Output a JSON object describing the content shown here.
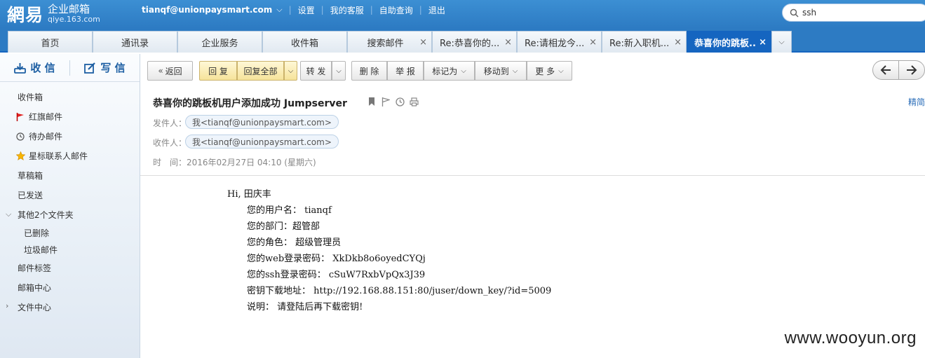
{
  "header": {
    "logo_brand": "網易",
    "logo_title": "企业邮箱",
    "logo_domain": "qiye.163.com",
    "user": "tianqf@unionpaysmart.com",
    "links": [
      "设置",
      "我的客服",
      "自助查询",
      "退出"
    ],
    "search_value": "ssh"
  },
  "tabs": [
    {
      "label": "首页"
    },
    {
      "label": "通讯录"
    },
    {
      "label": "企业服务"
    },
    {
      "label": "收件箱"
    },
    {
      "label": "搜索邮件"
    },
    {
      "label": "Re:恭喜你的..."
    },
    {
      "label": "Re:请相龙今..."
    },
    {
      "label": "Re:新入职机..."
    },
    {
      "label": "恭喜你的跳板.."
    }
  ],
  "sidebar": {
    "receive": "收 信",
    "compose": "写 信",
    "folders": [
      "收件箱",
      "红旗邮件",
      "待办邮件",
      "星标联系人邮件",
      "草稿箱",
      "已发送",
      "其他2个文件夹",
      "已删除",
      "垃圾邮件",
      "邮件标签",
      "邮箱中心",
      "文件中心"
    ]
  },
  "toolbar": {
    "back": "返回",
    "reply": "回 复",
    "reply_all": "回复全部",
    "forward": "转 发",
    "delete": "删 除",
    "report": "举 报",
    "mark_as": "标记为",
    "move_to": "移动到",
    "more": "更 多"
  },
  "mail": {
    "subject": "恭喜你的跳板机用户添加成功 Jumpserver",
    "simple_view": "精简",
    "from_label": "发件人：",
    "from": "我<tianqf@unionpaysmart.com>",
    "to_label": "收件人：",
    "to": "我<tianqf@unionpaysmart.com>",
    "time_label": "时　间：",
    "time": "2016年02月27日 04:10 (星期六)",
    "body": [
      "Hi, 田庆丰",
      "您的用户名： tianqf",
      "您的部门：超管部",
      "您的角色： 超级管理员",
      "您的web登录密码： XkDkb8o6oyedCYQj",
      "您的ssh登录密码： cSuW7RxbVpQx3J39",
      "密钥下载地址： http://192.168.88.151:80/juser/down_key/?id=5009",
      "说明： 请登陆后再下载密钥!"
    ]
  },
  "watermark": "www.wooyun.org"
}
